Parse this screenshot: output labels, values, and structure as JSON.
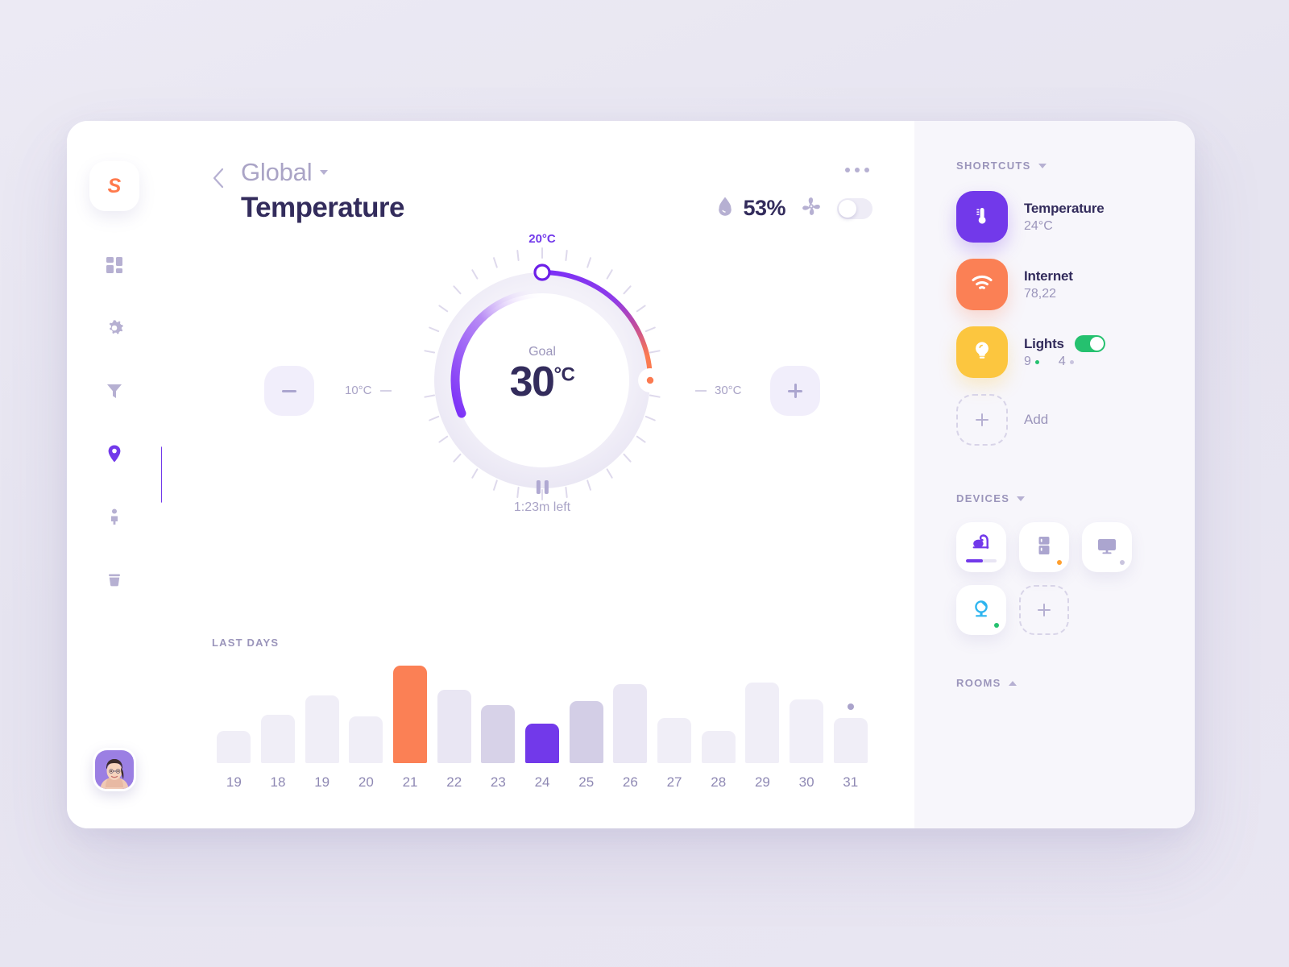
{
  "app": {
    "logo_text": "S"
  },
  "sidebar": {
    "items": [
      {
        "name": "dashboard",
        "icon": "grid-icon",
        "active": false
      },
      {
        "name": "settings",
        "icon": "gear-icon",
        "active": false
      },
      {
        "name": "filter",
        "icon": "funnel-icon",
        "active": false
      },
      {
        "name": "location",
        "icon": "location-pin-icon",
        "active": true
      },
      {
        "name": "profile",
        "icon": "person-icon",
        "active": false
      },
      {
        "name": "trash",
        "icon": "trash-icon",
        "active": false
      }
    ],
    "avatar_name": "user-avatar"
  },
  "header": {
    "breadcrumb": "Global",
    "title": "Temperature",
    "humidity_value": "53%",
    "fan_toggle_on": false,
    "more_menu": "..."
  },
  "gauge": {
    "top_label": "20°C",
    "goal_caption": "Goal",
    "goal_value": "30",
    "goal_unit": "°C",
    "range_min": "10°C",
    "range_max": "30°C",
    "timer_text": "1:23m left",
    "decrease_label": "−",
    "increase_label": "+"
  },
  "chart_data": {
    "type": "bar",
    "title": "LAST DAYS",
    "categories": [
      "19",
      "18",
      "19",
      "20",
      "21",
      "22",
      "23",
      "24",
      "25",
      "26",
      "27",
      "28",
      "29",
      "30",
      "31"
    ],
    "values": [
      34,
      52,
      72,
      50,
      104,
      78,
      62,
      42,
      66,
      84,
      48,
      34,
      86,
      68,
      48
    ],
    "colors": [
      "#f0eef7",
      "#f0eef7",
      "#f0eef7",
      "#f0eef7",
      "#fb8055",
      "#e9e6f3",
      "#d7d2e8",
      "#7239ea",
      "#d3cee6",
      "#eae7f4",
      "#f0eef7",
      "#f0eef7",
      "#f0eef7",
      "#f1eff8",
      "#f0eef7"
    ],
    "annotation_dot_index": 14,
    "xlabel": "",
    "ylabel": "",
    "ylim": [
      0,
      110
    ],
    "grid": false,
    "legend": "none"
  },
  "shortcuts": {
    "heading": "SHORTCUTS",
    "items": [
      {
        "icon": "thermometer-icon",
        "tile_color": "#7239ea",
        "name": "Temperature",
        "value": "24°C",
        "toggle": null
      },
      {
        "icon": "wifi-icon",
        "tile_color": "#fb8055",
        "name": "Internet",
        "value": "78,22",
        "toggle": null
      },
      {
        "icon": "lightbulb-icon",
        "tile_color": "#fcc63f",
        "name": "Lights",
        "value_on": "9",
        "value_off": "4",
        "toggle": true
      }
    ],
    "add_label": "Add"
  },
  "devices": {
    "heading": "DEVICES",
    "items": [
      {
        "icon": "vacuum-icon",
        "color": "#7239ea",
        "status_color": "",
        "progress": 55
      },
      {
        "icon": "fridge-icon",
        "color": "#aba5cf",
        "status_color": "#ff9f2e"
      },
      {
        "icon": "monitor-icon",
        "color": "#aba5cf",
        "status_color": "#c9c4de"
      },
      {
        "icon": "webcam-icon",
        "color": "#2fb5ef",
        "status_color": "#25c16f"
      }
    ],
    "add_name": "add-device"
  },
  "rooms": {
    "heading": "ROOMS"
  }
}
